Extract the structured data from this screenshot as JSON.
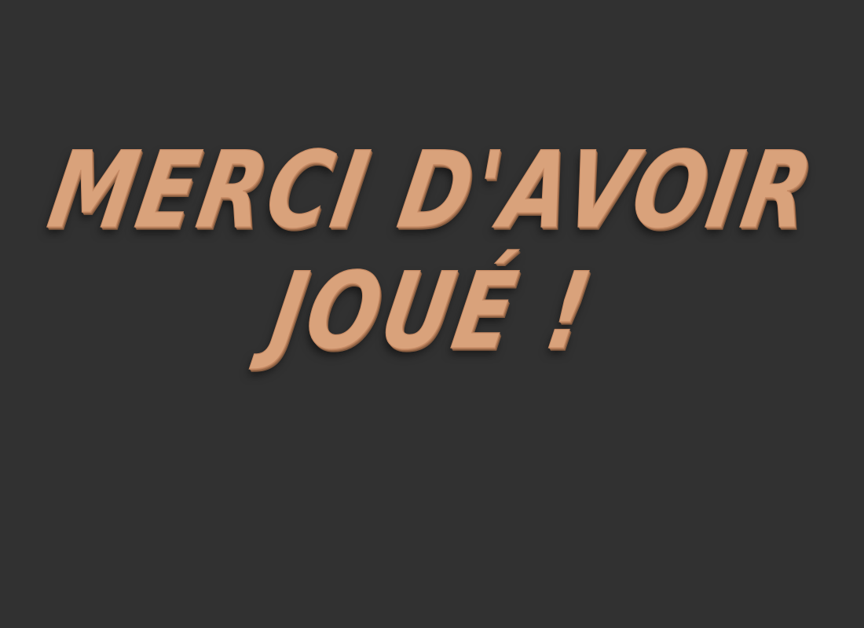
{
  "end_screen": {
    "title_line_1": "MERCI D'AVOIR",
    "title_line_2": "JOUÉ !"
  },
  "colors": {
    "background": "#313131",
    "title_wood": "#d9a27b"
  }
}
